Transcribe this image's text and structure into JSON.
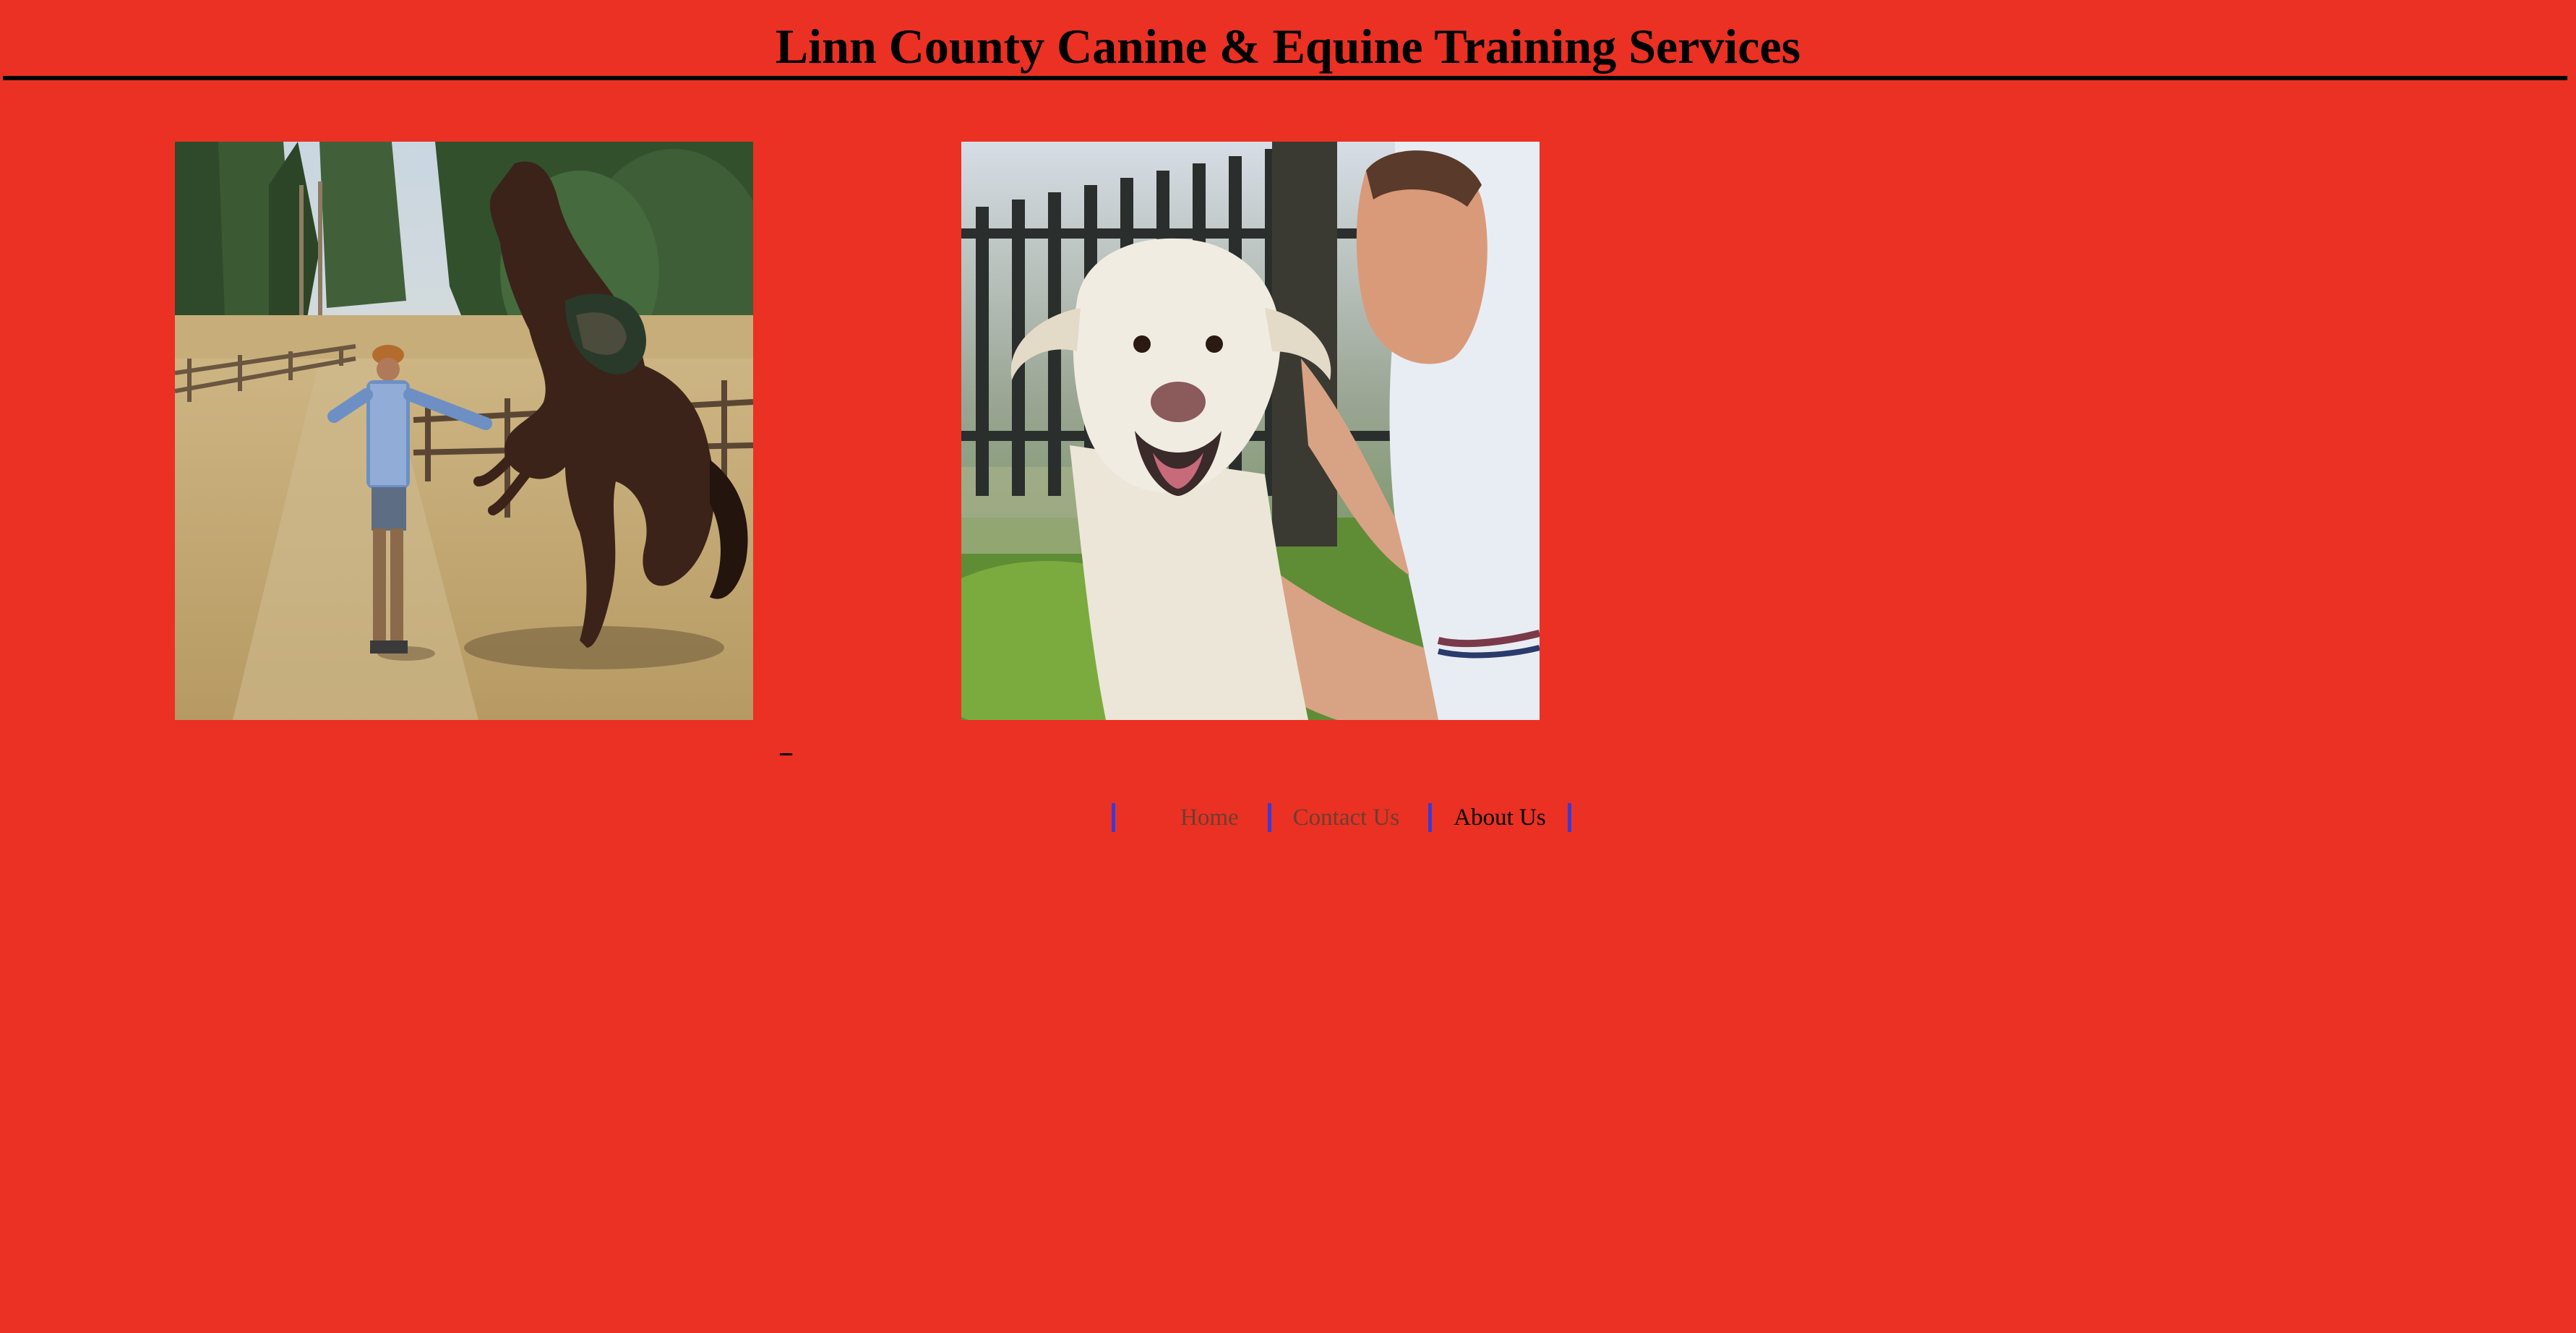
{
  "header": {
    "title": "Linn County Canine & Equine Training Services"
  },
  "images": {
    "horse": {
      "alt": "Trainer working with a rearing horse in a fenced field",
      "icon": "horse-photo"
    },
    "dog": {
      "alt": "Man holding the face of a smiling white dog by a fence",
      "icon": "dog-photo"
    }
  },
  "stray_link": {
    "text": "_"
  },
  "nav": {
    "items": [
      {
        "label": "Home"
      },
      {
        "label": "Contact Us"
      },
      {
        "label": "About Us"
      }
    ]
  },
  "colors": {
    "background": "#ea3123",
    "title": "#000000",
    "nav_separator": "#3a3ad6",
    "nav_link_visited": "#6b3e2e",
    "nav_link": "#000000"
  }
}
